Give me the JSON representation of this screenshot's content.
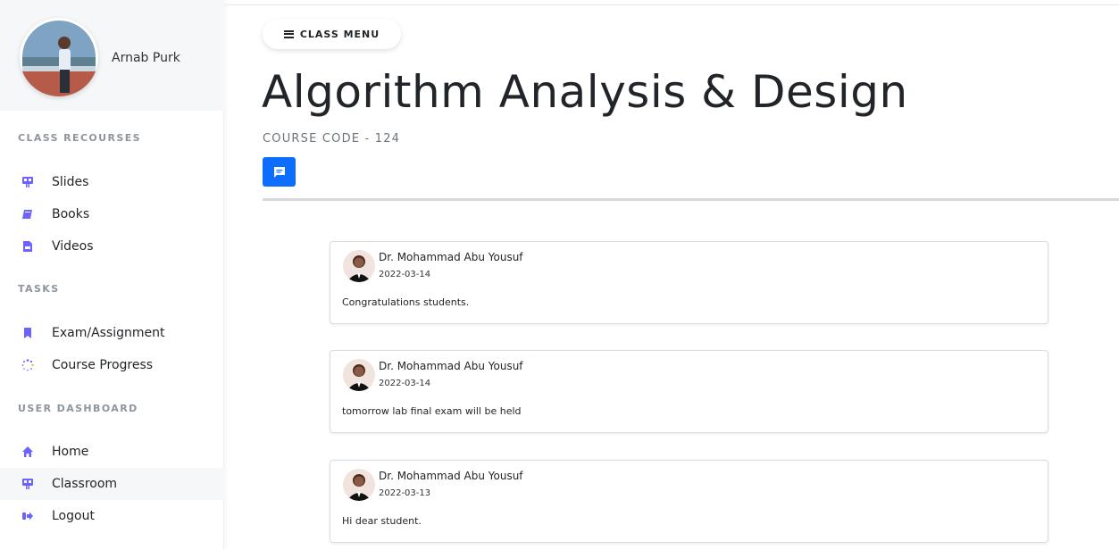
{
  "profile": {
    "name": "Arnab Purk"
  },
  "sidebar": {
    "sections": [
      {
        "label": "CLASS RECOURSES"
      },
      {
        "label": "TASKS"
      },
      {
        "label": "USER DASHBOARD"
      }
    ],
    "items": [
      {
        "label": "Slides",
        "icon": "slides-icon"
      },
      {
        "label": "Books",
        "icon": "book-icon"
      },
      {
        "label": "Videos",
        "icon": "video-file-icon"
      },
      {
        "label": "Exam/Assignment",
        "icon": "bookmark-icon"
      },
      {
        "label": "Course Progress",
        "icon": "spinner-icon"
      },
      {
        "label": "Home",
        "icon": "home-icon"
      },
      {
        "label": "Classroom",
        "icon": "classroom-icon"
      },
      {
        "label": "Logout",
        "icon": "logout-icon"
      }
    ]
  },
  "header": {
    "menu_label": "CLASS MENU",
    "title": "Algorithm Analysis & Design",
    "course_code": "COURSE CODE - 124"
  },
  "posts": [
    {
      "author": "Dr. Mohammad Abu Yousuf",
      "date": "2022-03-14",
      "text": "Congratulations students."
    },
    {
      "author": "Dr. Mohammad Abu Yousuf",
      "date": "2022-03-14",
      "text": "tomorrow lab final exam will be held"
    },
    {
      "author": "Dr. Mohammad Abu Yousuf",
      "date": "2022-03-13",
      "text": "Hi dear student."
    }
  ],
  "colors": {
    "accent": "#6c63ff",
    "primary_button": "#0d6efd"
  }
}
